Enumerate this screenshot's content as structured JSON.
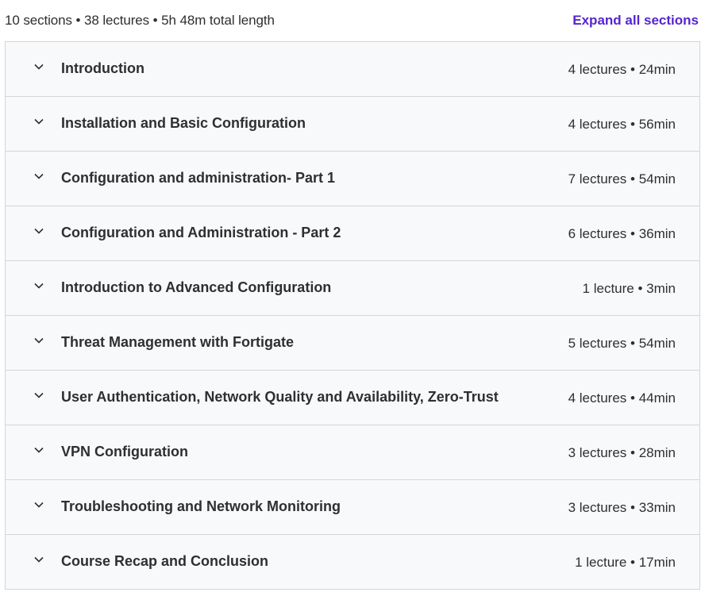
{
  "curriculum": {
    "summary": "10 sections • 38 lectures • 5h 48m total length",
    "expand_label": "Expand all sections",
    "sections": [
      {
        "title": "Introduction",
        "meta": "4 lectures • 24min"
      },
      {
        "title": "Installation and Basic Configuration",
        "meta": "4 lectures • 56min"
      },
      {
        "title": "Configuration and administration- Part 1",
        "meta": "7 lectures • 54min"
      },
      {
        "title": "Configuration and Administration - Part 2",
        "meta": "6 lectures • 36min"
      },
      {
        "title": "Introduction to Advanced Configuration",
        "meta": "1 lecture • 3min"
      },
      {
        "title": "Threat Management with Fortigate",
        "meta": "5 lectures • 54min"
      },
      {
        "title": "User Authentication, Network Quality and Availability, Zero-Trust",
        "meta": "4 lectures • 44min"
      },
      {
        "title": "VPN Configuration",
        "meta": "3 lectures • 28min"
      },
      {
        "title": "Troubleshooting and Network Monitoring",
        "meta": "3 lectures • 33min"
      },
      {
        "title": "Course Recap and Conclusion",
        "meta": "1 lecture • 17min"
      }
    ]
  },
  "icons": {
    "section_toggle": "chevron-down-icon"
  },
  "colors": {
    "accent": "#5624d0",
    "row_bg": "#f7f9fa",
    "border": "#d1d7dc",
    "text": "#2d2f31"
  }
}
